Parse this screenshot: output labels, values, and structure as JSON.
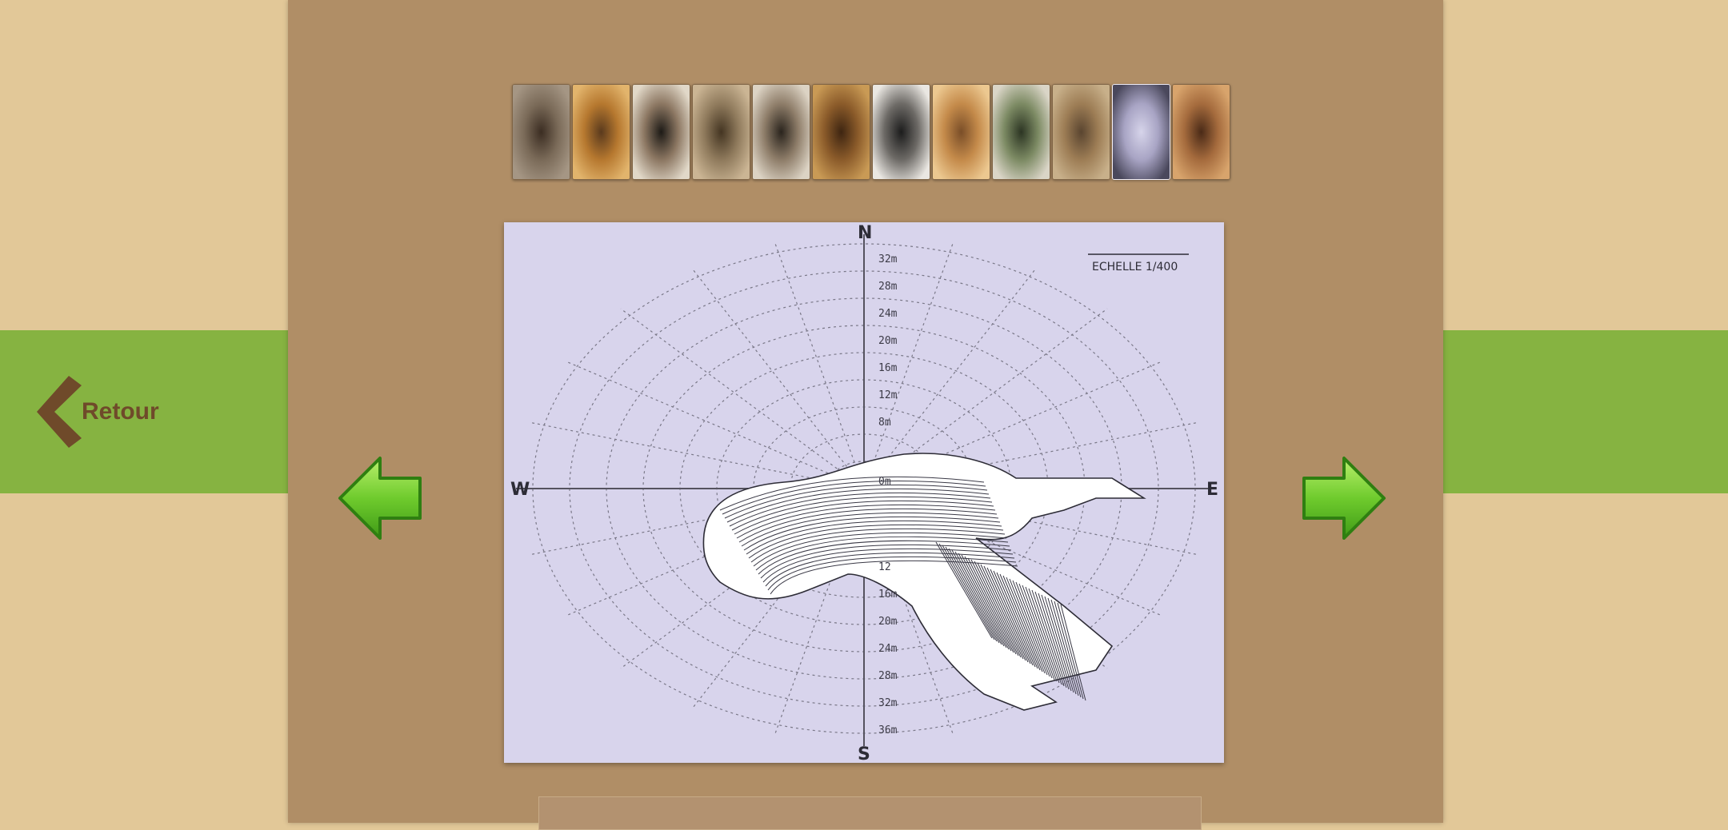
{
  "nav": {
    "back_label": "Retour"
  },
  "gallery": {
    "thumbnails": [
      {
        "name": "gallery-photo-1"
      },
      {
        "name": "gallery-photo-2"
      },
      {
        "name": "gallery-photo-3"
      },
      {
        "name": "gallery-photo-4"
      },
      {
        "name": "gallery-photo-5"
      },
      {
        "name": "gallery-photo-6"
      },
      {
        "name": "gallery-photo-7"
      },
      {
        "name": "gallery-photo-8"
      },
      {
        "name": "gallery-photo-9"
      },
      {
        "name": "gallery-photo-10"
      },
      {
        "name": "gallery-photo-11"
      },
      {
        "name": "gallery-photo-12"
      }
    ],
    "active_index": 11,
    "prev_icon": "arrow-left-icon",
    "next_icon": "arrow-right-icon"
  },
  "main_image": {
    "scale_label": "ECHELLE  1/400",
    "compass": {
      "n": "N",
      "s": "S",
      "e": "E",
      "w": "W"
    },
    "radius_labels_north": [
      "32m",
      "28m",
      "24m",
      "20m",
      "16m",
      "12m",
      "8m"
    ],
    "radius_labels_south": [
      "12",
      "16m",
      "20m",
      "24m",
      "28m",
      "32m",
      "36m"
    ],
    "center_label": "0m"
  },
  "colors": {
    "page_bg": "#e2c898",
    "panel_bg": "#b08e66",
    "accent_green": "#86b341",
    "back_text": "#6f4a2a",
    "arrow_green": "#5fb72a"
  }
}
